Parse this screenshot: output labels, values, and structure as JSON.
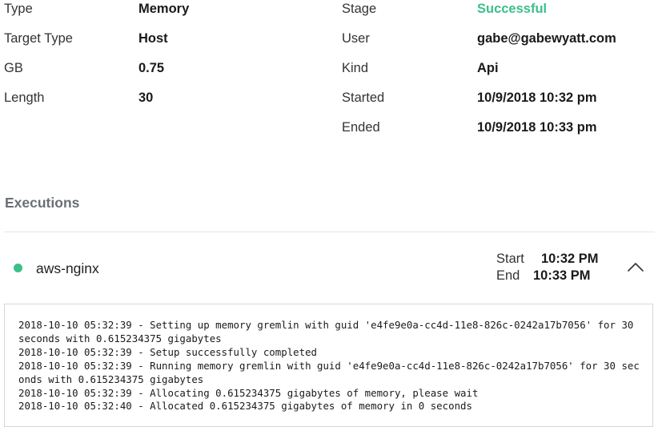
{
  "details": {
    "type_label": "Type",
    "type_value": "Memory",
    "target_type_label": "Target Type",
    "target_type_value": "Host",
    "gb_label": "GB",
    "gb_value": "0.75",
    "length_label": "Length",
    "length_value": "30",
    "stage_label": "Stage",
    "stage_value": "Successful",
    "user_label": "User",
    "user_value": "gabe@gabewyatt.com",
    "kind_label": "Kind",
    "kind_value": "Api",
    "started_label": "Started",
    "started_value": "10/9/2018 10:32 pm",
    "ended_label": "Ended",
    "ended_value": "10/9/2018 10:33 pm"
  },
  "executions": {
    "title": "Executions",
    "items": [
      {
        "name": "aws-nginx",
        "status_color": "#3cbf8a",
        "start_label": "Start",
        "start_value": "10:32 PM",
        "end_label": "End",
        "end_value": "10:33 PM",
        "expand_icon": "chevron-up-icon",
        "log_lines": [
          "2018-10-10 05:32:39 - Setting up memory gremlin with guid 'e4fe9e0a-cc4d-11e8-826c-0242a17b7056' for 30 seconds with 0.615234375 gigabytes",
          "2018-10-10 05:32:39 - Setup successfully completed",
          "2018-10-10 05:32:39 - Running memory gremlin with guid 'e4fe9e0a-cc4d-11e8-826c-0242a17b7056' for 30 seconds with 0.615234375 gigabytes",
          "2018-10-10 05:32:39 - Allocating 0.615234375 gigabytes of memory, please wait",
          "2018-10-10 05:32:40 - Allocated 0.615234375 gigabytes of memory in 0 seconds"
        ]
      }
    ]
  },
  "colors": {
    "success": "#3cbf8a",
    "section_title": "#6b6f76"
  }
}
